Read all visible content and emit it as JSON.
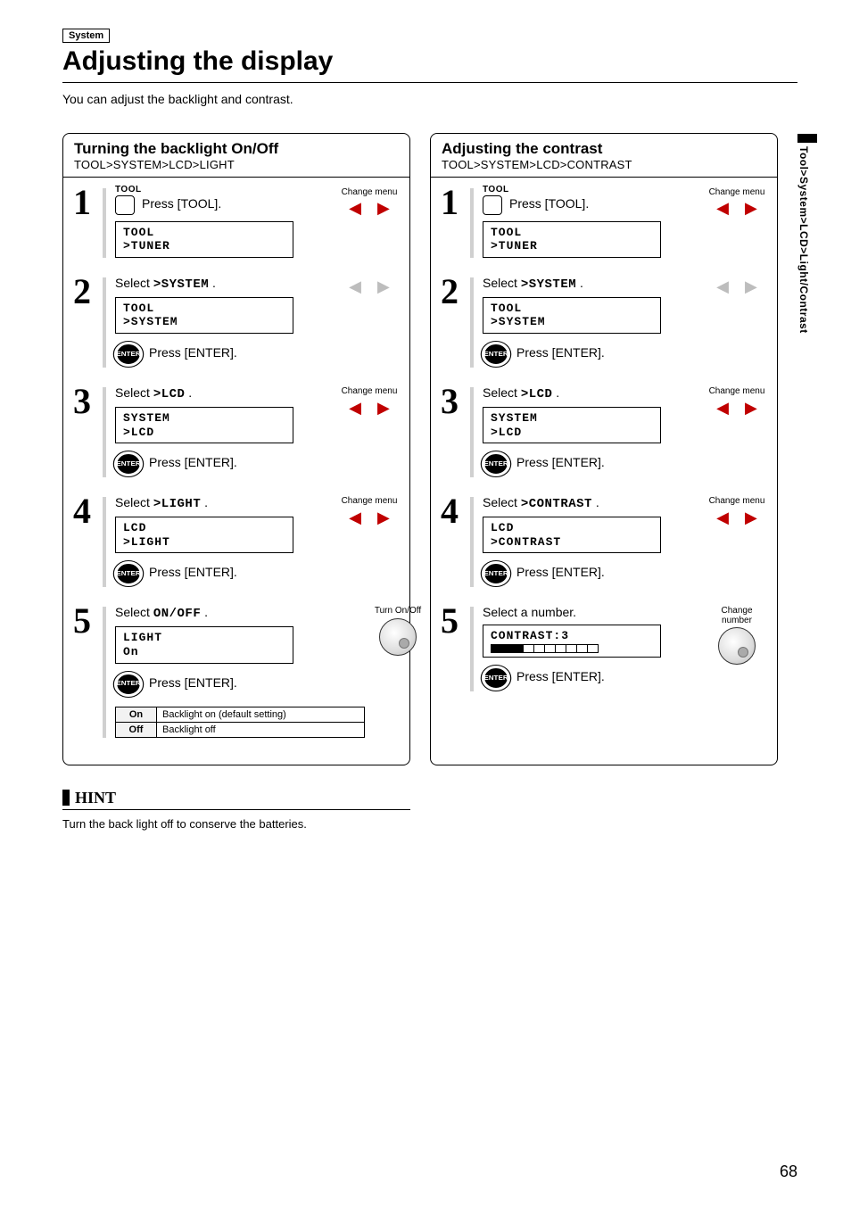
{
  "category_badge": "System",
  "page_title": "Adjusting the display",
  "intro": "You can adjust the backlight and contrast.",
  "side_tab": "Tool>System>LCD>Light/Contrast",
  "page_number": "68",
  "columns": [
    {
      "title": "Turning the backlight On/Off",
      "path": "TOOL>SYSTEM>LCD>LIGHT",
      "steps": [
        {
          "num": "1",
          "tool_label": "TOOL",
          "text": "Press [TOOL].",
          "lcd_l1": "TOOL",
          "lcd_l2": ">TUNER",
          "side_label": "Change menu",
          "side_kind": "arrows_active"
        },
        {
          "num": "2",
          "text_pre": "Select ",
          "text_seg": ">SYSTEM",
          "text_post": " .",
          "lcd_l1": "TOOL",
          "lcd_l2": ">SYSTEM",
          "enter_text": "Press [ENTER].",
          "side_kind": "arrows_inactive"
        },
        {
          "num": "3",
          "text_pre": "Select ",
          "text_seg": ">LCD",
          "text_post": " .",
          "lcd_l1": "SYSTEM",
          "lcd_l2": ">LCD",
          "enter_text": "Press [ENTER].",
          "side_label": "Change menu",
          "side_kind": "arrows_active"
        },
        {
          "num": "4",
          "text_pre": "Select ",
          "text_seg": ">LIGHT",
          "text_post": " .",
          "lcd_l1": "LCD",
          "lcd_l2": ">LIGHT",
          "enter_text": "Press [ENTER].",
          "side_label": "Change menu",
          "side_kind": "arrows_active"
        },
        {
          "num": "5",
          "text_pre": "Select ",
          "text_seg": "ON/OFF",
          "text_post": " .",
          "lcd_l1": "LIGHT",
          "lcd_l2": "On",
          "enter_text": "Press [ENTER].",
          "side_label": "Turn On/Off",
          "side_kind": "jog",
          "options": [
            {
              "k": "On",
              "v": "Backlight on (default setting)"
            },
            {
              "k": "Off",
              "v": "Backlight off"
            }
          ]
        }
      ]
    },
    {
      "title": "Adjusting the contrast",
      "path": "TOOL>SYSTEM>LCD>CONTRAST",
      "steps": [
        {
          "num": "1",
          "tool_label": "TOOL",
          "text": "Press [TOOL].",
          "lcd_l1": "TOOL",
          "lcd_l2": ">TUNER",
          "side_label": "Change menu",
          "side_kind": "arrows_active"
        },
        {
          "num": "2",
          "text_pre": "Select ",
          "text_seg": ">SYSTEM",
          "text_post": " .",
          "lcd_l1": "TOOL",
          "lcd_l2": ">SYSTEM",
          "enter_text": "Press [ENTER].",
          "side_kind": "arrows_inactive"
        },
        {
          "num": "3",
          "text_pre": "Select ",
          "text_seg": ">LCD",
          "text_post": " .",
          "lcd_l1": "SYSTEM",
          "lcd_l2": ">LCD",
          "enter_text": "Press [ENTER].",
          "side_label": "Change menu",
          "side_kind": "arrows_active"
        },
        {
          "num": "4",
          "text_pre": "Select ",
          "text_seg": ">CONTRAST",
          "text_post": " .",
          "lcd_l1": "LCD",
          "lcd_l2": ">CONTRAST",
          "enter_text": "Press [ENTER].",
          "side_label": "Change menu",
          "side_kind": "arrows_active"
        },
        {
          "num": "5",
          "text": "Select a number.",
          "lcd_l1": "CONTRAST:3",
          "contrast_bars": [
            true,
            true,
            true,
            false,
            false,
            false,
            false,
            false,
            false,
            false
          ],
          "enter_text": "Press [ENTER].",
          "side_label": "Change number",
          "side_kind": "jog"
        }
      ]
    }
  ],
  "hint": {
    "title": "HINT",
    "body": "Turn the back light off to conserve the batteries."
  },
  "enter_label": "ENTER",
  "arrow_left": "◀",
  "arrow_right": "▶"
}
